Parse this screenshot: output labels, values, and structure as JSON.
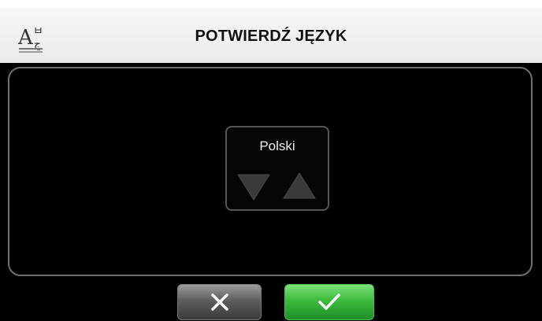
{
  "header": {
    "title": "POTWIERDŹ JĘZYK",
    "language_icon": "language-translate-icon"
  },
  "language_selector": {
    "selected_language": "Polski",
    "down_icon": "triangle-down-icon",
    "up_icon": "triangle-up-icon"
  },
  "buttons": {
    "cancel_icon": "close-x-icon",
    "confirm_icon": "checkmark-icon"
  },
  "colors": {
    "background": "#000000",
    "header": "#f0f0f0",
    "confirm": "#3cbb3c",
    "cancel": "#4a4a4a"
  }
}
